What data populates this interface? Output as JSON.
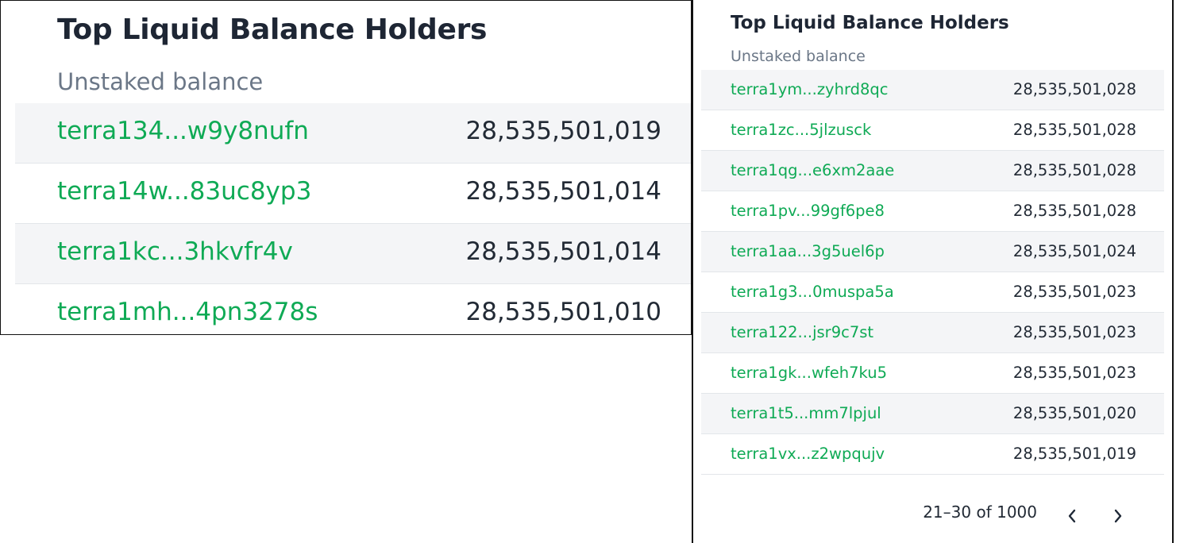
{
  "left_panel": {
    "title": "Top Liquid Balance Holders",
    "subtitle": "Unstaked balance",
    "rows": [
      {
        "address": "terra134...w9y8nufn",
        "balance": "28,535,501,019"
      },
      {
        "address": "terra14w...83uc8yp3",
        "balance": "28,535,501,014"
      },
      {
        "address": "terra1kc...3hkvfr4v",
        "balance": "28,535,501,014"
      },
      {
        "address": "terra1mh...4pn3278s",
        "balance": "28,535,501,010"
      }
    ]
  },
  "right_panel": {
    "title": "Top Liquid Balance Holders",
    "subtitle": "Unstaked balance",
    "rows": [
      {
        "address": "terra1ym...zyhrd8qc",
        "balance": "28,535,501,028"
      },
      {
        "address": "terra1zc...5jlzusck",
        "balance": "28,535,501,028"
      },
      {
        "address": "terra1qg...e6xm2aae",
        "balance": "28,535,501,028"
      },
      {
        "address": "terra1pv...99gf6pe8",
        "balance": "28,535,501,028"
      },
      {
        "address": "terra1aa...3g5uel6p",
        "balance": "28,535,501,024"
      },
      {
        "address": "terra1g3...0muspa5a",
        "balance": "28,535,501,023"
      },
      {
        "address": "terra122...jsr9c7st",
        "balance": "28,535,501,023"
      },
      {
        "address": "terra1gk...wfeh7ku5",
        "balance": "28,535,501,023"
      },
      {
        "address": "terra1t5...mm7lpjul",
        "balance": "28,535,501,020"
      },
      {
        "address": "terra1vx...z2wpqujv",
        "balance": "28,535,501,019"
      }
    ],
    "pagination": {
      "range_text": "21–30 of 1000",
      "prev_icon": "chevron-left-icon",
      "next_icon": "chevron-right-icon"
    }
  },
  "colors": {
    "address_link": "#0faa55",
    "row_shade": "#f4f5f7",
    "title": "#1e2634",
    "subtitle": "#6b7787"
  }
}
